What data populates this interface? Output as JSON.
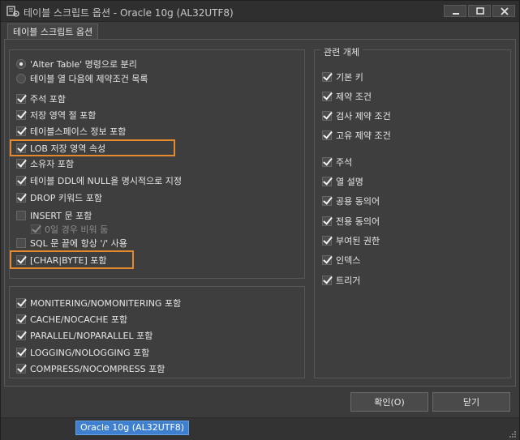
{
  "window": {
    "title": "테이블 스크립트 옵션 - Oracle 10g (AL32UTF8)"
  },
  "tabs": [
    {
      "label": "테이블 스크립트 옵션",
      "active": true
    }
  ],
  "left_top": {
    "radios": [
      {
        "label": "'Alter Table' 명령으로 분리",
        "selected": true
      },
      {
        "label": "테이블 열 다음에 제약조건 목록",
        "selected": false
      }
    ],
    "checks": [
      {
        "label": "주석 포함",
        "checked": true
      },
      {
        "label": "저장 영역 절 포함",
        "checked": true
      },
      {
        "label": "테이블스페이스 정보 포함",
        "checked": true
      },
      {
        "label": "LOB 저장 영역 속성",
        "checked": true
      },
      {
        "label": "소유자 포함",
        "checked": true
      },
      {
        "label": "테이블 DDL에 NULL을 명시적으로 지정",
        "checked": true
      },
      {
        "label": "DROP 키워드 포함",
        "checked": true
      },
      {
        "label": "INSERT 문 포함",
        "checked": false
      },
      {
        "label": "0일 경우 비워 둠",
        "checked": true,
        "disabled": true
      },
      {
        "label": "SQL 문 끝에 항상 '/' 사용",
        "checked": false
      },
      {
        "label": "[CHAR|BYTE] 포함",
        "checked": true
      }
    ]
  },
  "left_bottom": {
    "checks": [
      {
        "label": "MONITERING/NOMONITERING 포함",
        "checked": true
      },
      {
        "label": "CACHE/NOCACHE 포함",
        "checked": true
      },
      {
        "label": "PARALLEL/NOPARALLEL 포함",
        "checked": true
      },
      {
        "label": "LOGGING/NOLOGGING 포함",
        "checked": true
      },
      {
        "label": "COMPRESS/NOCOMPRESS 포함",
        "checked": true
      }
    ]
  },
  "right": {
    "title": "관련 개체",
    "checks": [
      {
        "label": "기본 키",
        "checked": true
      },
      {
        "label": "제약 조건",
        "checked": true
      },
      {
        "label": "검사 제약 조건",
        "checked": true
      },
      {
        "label": "고유 제약 조건",
        "checked": true
      },
      {
        "label": "주석",
        "checked": true
      },
      {
        "label": "열 설명",
        "checked": true
      },
      {
        "label": "공용 동의어",
        "checked": true
      },
      {
        "label": "전용 동의어",
        "checked": true
      },
      {
        "label": "부여된 권한",
        "checked": true
      },
      {
        "label": "인덱스",
        "checked": true
      },
      {
        "label": "트리거",
        "checked": true
      }
    ]
  },
  "buttons": {
    "ok": "확인(O)",
    "close": "닫기"
  },
  "status": {
    "connection": "Oracle 10g (AL32UTF8)"
  },
  "colors": {
    "background": "#3b3b3b",
    "highlight": "#e48a2e",
    "status_chip": "#3f7fd0"
  }
}
